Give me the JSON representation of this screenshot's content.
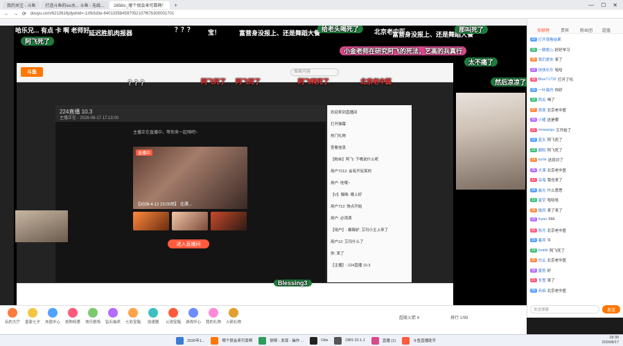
{
  "browser": {
    "tabs": [
      {
        "label": "我的关注 - 斗鱼",
        "active": false
      },
      {
        "label": "打造斗鱼的ios水... 斗鱼 - 无线...",
        "active": false
      },
      {
        "label": "2858/c_哪个很会来可靠啊！",
        "active": true
      }
    ],
    "url": "douyu.com/6213616jdyehid=-1zfb3d3e-640133584597052107f67b300001701",
    "new_tab": "+"
  },
  "danmu": [
    {
      "text": "哈乐兄... 有点 卡 啊  老师好",
      "style": "plain"
    },
    {
      "text": "延迟胜肌肉报器",
      "style": "plain"
    },
    {
      "text": "？？？",
      "style": "plain"
    },
    {
      "text": "宝！",
      "style": "plain"
    },
    {
      "text": "富营身没报上、还是舞蹈大餐",
      "style": "plain"
    },
    {
      "text": "给老头喝死了",
      "style": "pill"
    },
    {
      "text": "北京老中医",
      "style": "plain"
    },
    {
      "text": "富营身没报上、还是舞蹈大餐",
      "style": "plain"
    },
    {
      "text": "那叫死了",
      "style": "pill"
    },
    {
      "text": "阿飞死了",
      "style": "pill"
    },
    {
      "text": "小金老师在研究阿飞的死法，艺高的兵真行",
      "style": "pink"
    },
    {
      "text": "太不痛了",
      "style": "pill"
    },
    {
      "text": "阿飞死了",
      "style": "red"
    },
    {
      "text": "阿飞死了",
      "style": "red"
    },
    {
      "text": "阿飞鸭死了",
      "style": "red"
    },
    {
      "text": "北京老中医",
      "style": "red"
    },
    {
      "text": "然后凉凉了",
      "style": "pill"
    },
    {
      "text": "？？？",
      "style": "plain"
    },
    {
      "text": "Blessing3",
      "style": "pill"
    }
  ],
  "inner": {
    "logo": "斗鱼",
    "search_placeholder": "搜索内容",
    "room_title": "224直播 10.3",
    "room_meta": "主播正在 · 2026-08-17 17:13:00",
    "status": "主播正在直播中，等你来一起嗨吧~",
    "preview_badge": "直播中",
    "preview_caption": "【2026-4-12 23:00场】 北漂...",
    "enter_label": "进入直播间",
    "chat_lines": [
      "欢迎来到直播间",
      "打开弹幕",
      "热门礼物",
      "查看信息",
      "【粉丝】阿飞: 下嘴说什么呢",
      "用户7212: 会有开玩笑的",
      "用户: 哇哦~",
      "【V】猫咪: 晚上好",
      "用户712: 快点开始",
      "用户: 必须滴",
      "【用户】: 暴躁驴, 艾玛小主上来了",
      "用户12: 艾玛什么了",
      "你: 来了",
      "【主播】: 224直播 10.3"
    ]
  },
  "right_panel": {
    "tabs": [
      "贡献榜",
      "贵宾",
      "粉丝团",
      "超值"
    ],
    "active_tab": 0,
    "messages": [
      {
        "level": "20",
        "user": "打开观看结果",
        "text": ""
      },
      {
        "level": "15",
        "user": "一颗爱心",
        "text": "好好学习"
      },
      {
        "level": "30",
        "user": "我们爱你",
        "text": "来了"
      },
      {
        "level": "22",
        "user": "快快乐乐",
        "text": "哈哈"
      },
      {
        "level": "18",
        "user": "Blue71732",
        "text": "打开了吗"
      },
      {
        "level": "25",
        "user": "一叶扁舟",
        "text": "你好"
      },
      {
        "level": "12",
        "user": "西瓜",
        "text": "喝了"
      },
      {
        "level": "27",
        "user": "雨夜",
        "text": "北京老中医"
      },
      {
        "level": "16",
        "user": "小猪",
        "text": "这是哪"
      },
      {
        "level": "21",
        "user": "mowangs",
        "text": "又开始了"
      },
      {
        "level": "19",
        "user": "蓝天",
        "text": "阿飞死了"
      },
      {
        "level": "23",
        "user": "朝阳",
        "text": "阿飞死了"
      },
      {
        "level": "14",
        "user": "turtle",
        "text": "这就对了"
      },
      {
        "level": "26",
        "user": "大漠",
        "text": "北京老中医"
      },
      {
        "level": "17",
        "user": "深海",
        "text": "我也来了"
      },
      {
        "level": "24",
        "user": "晨光",
        "text": "什么意思"
      },
      {
        "level": "13",
        "user": "星空",
        "text": "哈哈哈"
      },
      {
        "level": "28",
        "user": "微风",
        "text": "来了来了"
      },
      {
        "level": "20",
        "user": "lvyan",
        "text": "666"
      },
      {
        "level": "22",
        "user": "秋月",
        "text": "北京老中医"
      },
      {
        "level": "15",
        "user": "春风",
        "text": "牛"
      },
      {
        "level": "19",
        "user": "kuaile",
        "text": "阿飞死了"
      },
      {
        "level": "25",
        "user": "白云",
        "text": "北京老中医"
      },
      {
        "level": "18",
        "user": "夏雨",
        "text": "好"
      },
      {
        "level": "21",
        "user": "冬雪",
        "text": "来了"
      },
      {
        "level": "30",
        "user": "赤焰",
        "text": "北京老中医"
      }
    ],
    "input_placeholder": "发送弹幕",
    "send_label": "发送"
  },
  "lower_bar": {
    "items": [
      "玩的大厅",
      "皇家七夕",
      "充值中心",
      "抢购特惠",
      "快乐剧场",
      "钻石抽奖",
      "七彩宝箱",
      "加速器",
      "公测宝箱",
      "游戏中心",
      "我的礼物",
      "火箭礼物"
    ],
    "rocket_label": "超级火箭 4",
    "rank_label": "排行 1/99"
  },
  "taskbar": {
    "apps": [
      "2026年1...",
      "哪个很会来可靠啊",
      "钢琴 - 发现 - 操作 ...",
      "Obs",
      "OBS 32.1.1",
      "直播 (1)",
      "斗鱼直播助手"
    ],
    "time": "18:30",
    "date": "2026/8/17"
  },
  "colors": {
    "accent": "#ff5a3c",
    "douyu_orange": "#ff7700",
    "danmu_green": "#1e7d3d",
    "danmu_red": "#ff3b3b"
  }
}
